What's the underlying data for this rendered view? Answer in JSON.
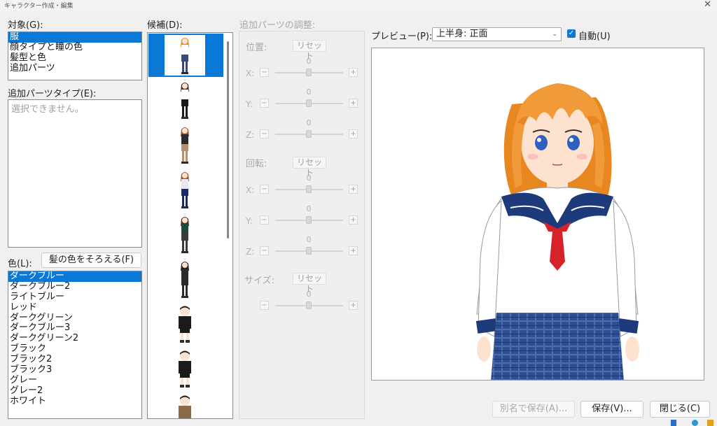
{
  "window": {
    "title": "キャラクター作成・編集"
  },
  "target": {
    "label": "対象(G):",
    "items": [
      {
        "label": "服",
        "selected": true
      },
      {
        "label": "顔タイプと瞳の色",
        "selected": false
      },
      {
        "label": "髪型と色",
        "selected": false
      },
      {
        "label": "追加パーツ",
        "selected": false
      }
    ]
  },
  "extra_parts_type": {
    "label": "追加パーツタイプ(E):",
    "placeholder": "選択できません。"
  },
  "color": {
    "label": "色(L):",
    "match_hair_button": "髪の色をそろえる(F)",
    "items": [
      {
        "label": "ダークブルー",
        "selected": true
      },
      {
        "label": "ダークブルー2",
        "selected": false
      },
      {
        "label": "ライトブルー",
        "selected": false
      },
      {
        "label": "レッド",
        "selected": false
      },
      {
        "label": "ダークグリーン",
        "selected": false
      },
      {
        "label": "ダークブルー3",
        "selected": false
      },
      {
        "label": "ダークグリーン2",
        "selected": false
      },
      {
        "label": "ブラック",
        "selected": false
      },
      {
        "label": "ブラック2",
        "selected": false
      },
      {
        "label": "ブラック3",
        "selected": false
      },
      {
        "label": "グレー",
        "selected": false
      },
      {
        "label": "グレー2",
        "selected": false
      },
      {
        "label": "ホワイト",
        "selected": false
      }
    ]
  },
  "candidates": {
    "label": "候補(D):",
    "items": [
      {
        "outfit": "sailor-uniform",
        "hair": "#e08a2a",
        "top": "#ffffff",
        "bottom": "#3a4a7a",
        "selected": true
      },
      {
        "outfit": "blazer",
        "hair": "#4a2a2a",
        "top": "#ffffff",
        "bottom": "#1a1a1a",
        "selected": false
      },
      {
        "outfit": "sweater-plaid",
        "hair": "#a0502a",
        "top": "#2a2a2a",
        "bottom": "#b89070",
        "selected": false
      },
      {
        "outfit": "shirt-jeans",
        "hair": "#a0502a",
        "top": "#e8e8f0",
        "bottom": "#1a2a6a",
        "selected": false
      },
      {
        "outfit": "green-jacket",
        "hair": "#5a2a1a",
        "top": "#1f4a3a",
        "bottom": "#3a3a3a",
        "selected": false
      },
      {
        "outfit": "dark-suit",
        "hair": "#2a1a1a",
        "top": "#2a2a2a",
        "bottom": "#2a2a2a",
        "selected": false
      },
      {
        "outfit": "gakuran-short",
        "hair": "#1a1a1a",
        "top": "#1a1a1a",
        "bottom": "#1a1a1a",
        "selected": false
      },
      {
        "outfit": "gakuran-short-2",
        "hair": "#1a1a1a",
        "top": "#1a1a1a",
        "bottom": "#1a1a1a",
        "selected": false
      },
      {
        "outfit": "brown-jacket-short",
        "hair": "#1a1a1a",
        "top": "#8a6a4a",
        "bottom": "#5a4a3a",
        "selected": false
      }
    ]
  },
  "adjust": {
    "label": "追加パーツの調整:",
    "position": {
      "label": "位置:",
      "reset": "リセット",
      "x_label": "X:",
      "y_label": "Y:",
      "z_label": "Z:",
      "x": "0",
      "y": "0",
      "z": "0"
    },
    "rotation": {
      "label": "回転:",
      "reset": "リセット",
      "x_label": "X:",
      "y_label": "Y:",
      "z_label": "Z:",
      "x": "0",
      "y": "0",
      "z": "0"
    },
    "size": {
      "label": "サイズ:",
      "reset": "リセット",
      "value": "0"
    },
    "minus": "−",
    "plus": "+"
  },
  "preview": {
    "label": "プレビュー(P):",
    "view_value": "上半身: 正面",
    "auto_label": "自動(U)",
    "auto_checked": true
  },
  "buttons": {
    "save_as": "別名で保存(A)...",
    "save": "保存(V)...",
    "close": "閉じる(C)"
  },
  "colors": {
    "accent": "#0a78d7",
    "hair": "#f09a3a",
    "uniform_navy": "#1d3a7a",
    "tie": "#d8222a",
    "skirt": "#2e4f8f"
  }
}
